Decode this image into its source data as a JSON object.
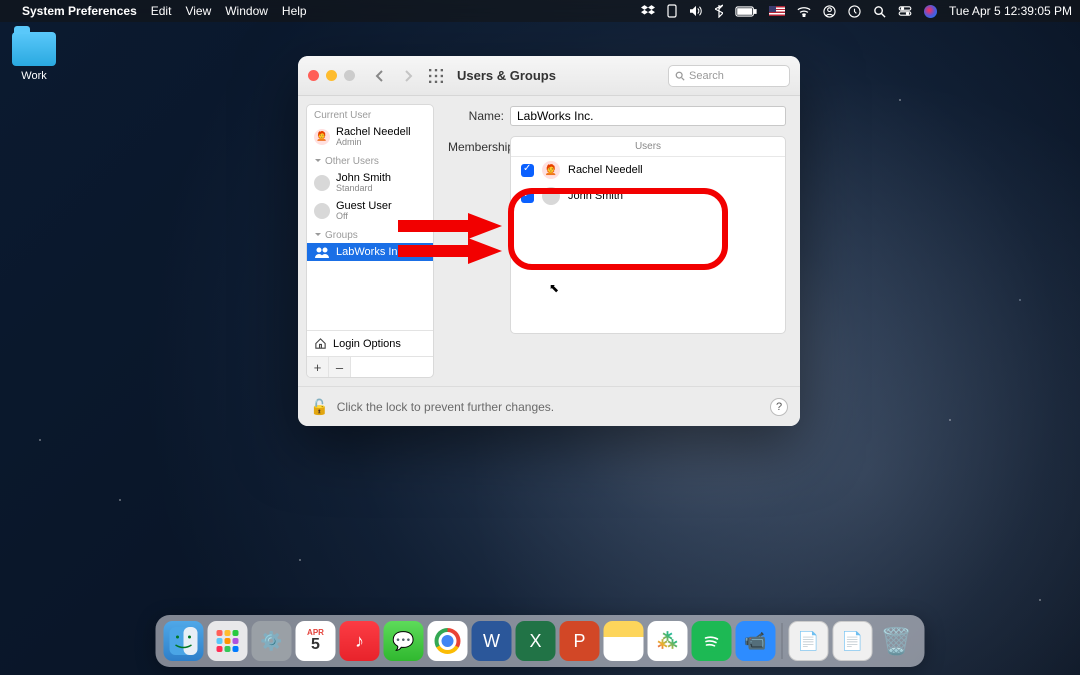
{
  "menubar": {
    "app_name": "System Preferences",
    "menus": [
      "Edit",
      "View",
      "Window",
      "Help"
    ],
    "datetime": "Tue Apr 5  12:39:05 PM"
  },
  "desktop": {
    "folder_label": "Work"
  },
  "window": {
    "title": "Users & Groups",
    "search_placeholder": "Search",
    "name_label": "Name:",
    "name_value": "LabWorks Inc.",
    "membership_label": "Membership:",
    "users_header": "Users",
    "lock_text": "Click the lock to prevent further changes.",
    "login_options_label": "Login Options"
  },
  "sidebar": {
    "current_label": "Current User",
    "other_label": "Other Users",
    "groups_label": "Groups",
    "current_user": {
      "name": "Rachel Needell",
      "role": "Admin"
    },
    "others": [
      {
        "name": "John Smith",
        "role": "Standard"
      },
      {
        "name": "Guest User",
        "role": "Off"
      }
    ],
    "groups": [
      {
        "name": "LabWorks Inc."
      }
    ],
    "add": "+",
    "remove": "–"
  },
  "members": [
    {
      "name": "Rachel Needell",
      "checked": true
    },
    {
      "name": "John Smith",
      "checked": true
    }
  ],
  "dock": {
    "calendar_month": "APR",
    "calendar_day": "5"
  },
  "help": "?"
}
